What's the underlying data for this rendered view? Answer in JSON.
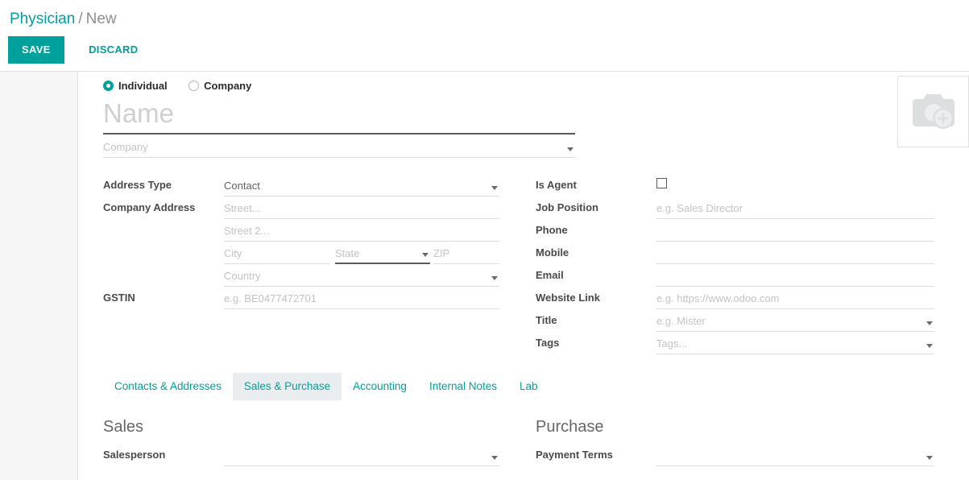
{
  "breadcrumb": {
    "root": "Physician",
    "separator": "/",
    "current": "New"
  },
  "actions": {
    "save_label": "SAVE",
    "discard_label": "DISCARD"
  },
  "colors": {
    "accent": "#00a09d",
    "label_text": "#4a4a4a",
    "placeholder": "#c3c3c3",
    "tab_active_bg": "#e9edef",
    "gutter_bg": "#f6f6f6"
  },
  "entity_type": {
    "options": [
      {
        "label": "Individual",
        "selected": true
      },
      {
        "label": "Company",
        "selected": false
      }
    ]
  },
  "header_fields": {
    "name": {
      "placeholder": "Name",
      "value": "",
      "focused": true
    },
    "company": {
      "placeholder": "Company",
      "value": "",
      "widget": "dropdown"
    }
  },
  "avatar": {
    "icon": "camera-plus-icon",
    "alt": "Add image"
  },
  "left_column": [
    {
      "label": "Address Type",
      "placeholder": "Contact",
      "value": "Contact",
      "filled": true,
      "widget": "dropdown",
      "name": "address-type"
    },
    {
      "label": "Company Address",
      "placeholder": "Street...",
      "value": "",
      "widget": "text",
      "name": "street"
    },
    {
      "label": "",
      "placeholder": "Street 2...",
      "value": "",
      "widget": "text",
      "name": "street2"
    },
    {
      "label": "",
      "placeholder": "",
      "value": "",
      "widget": "city-state-zip",
      "name": "city-state-zip"
    },
    {
      "label": "",
      "placeholder": "Country",
      "value": "",
      "widget": "dropdown",
      "name": "country"
    },
    {
      "label": "GSTIN",
      "placeholder": "e.g. BE0477472701",
      "value": "",
      "widget": "text",
      "name": "gstin"
    }
  ],
  "address_parts": {
    "city": {
      "placeholder": "City",
      "value": ""
    },
    "state": {
      "placeholder": "State",
      "value": "",
      "widget": "dropdown",
      "focused": true
    },
    "zip": {
      "placeholder": "ZIP",
      "value": ""
    }
  },
  "right_column": [
    {
      "label": "Is Agent",
      "placeholder": "",
      "value": "",
      "widget": "checkbox",
      "checked": false,
      "name": "is-agent"
    },
    {
      "label": "Job Position",
      "placeholder": "e.g. Sales Director",
      "value": "",
      "widget": "text",
      "name": "job-position"
    },
    {
      "label": "Phone",
      "placeholder": "",
      "value": "",
      "widget": "text",
      "name": "phone"
    },
    {
      "label": "Mobile",
      "placeholder": "",
      "value": "",
      "widget": "text",
      "name": "mobile"
    },
    {
      "label": "Email",
      "placeholder": "",
      "value": "",
      "widget": "text",
      "name": "email"
    },
    {
      "label": "Website Link",
      "placeholder": "e.g. https://www.odoo.com",
      "value": "",
      "widget": "text",
      "name": "website-link"
    },
    {
      "label": "Title",
      "placeholder": "e.g. Mister",
      "value": "",
      "widget": "dropdown",
      "name": "title"
    },
    {
      "label": "Tags",
      "placeholder": "Tags...",
      "value": "",
      "widget": "dropdown",
      "name": "tags"
    }
  ],
  "tabs": [
    {
      "label": "Contacts & Addresses",
      "active": false
    },
    {
      "label": "Sales & Purchase",
      "active": true
    },
    {
      "label": "Accounting",
      "active": false
    },
    {
      "label": "Internal Notes",
      "active": false
    },
    {
      "label": "Lab",
      "active": false
    }
  ],
  "sales_section": {
    "title": "Sales",
    "fields": [
      {
        "label": "Salesperson",
        "placeholder": "",
        "value": "",
        "widget": "dropdown",
        "name": "salesperson"
      }
    ]
  },
  "purchase_section": {
    "title": "Purchase",
    "fields": [
      {
        "label": "Payment Terms",
        "placeholder": "",
        "value": "",
        "widget": "dropdown",
        "name": "payment-terms"
      }
    ]
  }
}
